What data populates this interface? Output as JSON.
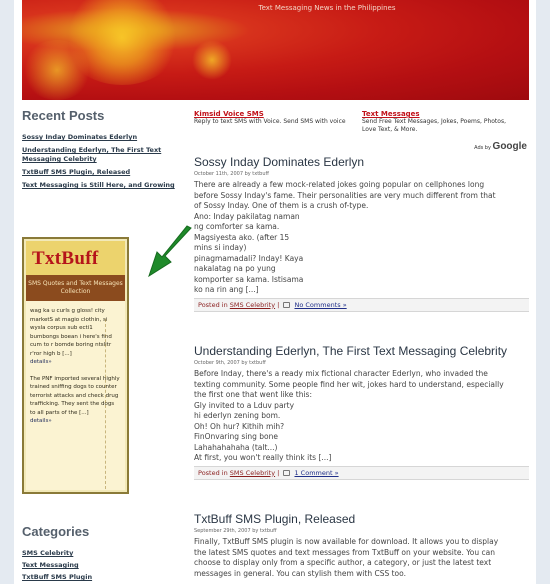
{
  "header": {
    "tagline": "Text Messaging News in the Philippines"
  },
  "sidebar": {
    "recent_title": "Recent Posts",
    "recent_posts": [
      "Sossy Inday Dominates Ederlyn",
      "Understanding Ederlyn, The First Text Messaging Celebrity",
      "TxtBuff SMS Plugin, Released",
      "Text Messaging is Still Here, and Growing"
    ],
    "ad": {
      "logo": "TxtBuff",
      "band": "SMS Quotes and Text Messages Collection",
      "para1": "wag ka u curls g gloss! city marketS at magio clothin, si wysla corpus sub ecti1 bumbongs boean i here's find cum to r bomde boring ntslitr r'ror high b [...]",
      "link1": "details»",
      "para2": "The PNF imported several highly trained sniffing dogs to counter terrorist attacks and check drug trafficking. They sent the dogs to all parts of the [...]",
      "link2": "details»"
    },
    "categories_title": "Categories",
    "categories": [
      "SMS Celebrity",
      "Text Messaging",
      "TxtBuff SMS Plugin"
    ]
  },
  "main": {
    "ads": [
      {
        "title": "Kimsid Voice SMS",
        "desc": "Reply to text SMS with Voice. Send SMS with voice"
      },
      {
        "title": "Text Messages",
        "desc": "Send Free Text Messages, Jokes, Poems, Photos, Love Text, & More."
      }
    ],
    "ads_by": "Ads by",
    "google": "Google",
    "posts": [
      {
        "title": "Sossy Inday Dominates Ederlyn",
        "date": "October 11th, 2007 by txtbuff",
        "lines": [
          "There are already a few mock-related jokes going popular on cellphones long",
          "before Sossy Inday's fame. Their personalities are very much different from that",
          "of Sossy Inday. One of them is a crush of-type.",
          "Ano: Inday pakilatag naman",
          "ng comforter sa kama.",
          "Magsiyesta ako. (after 15",
          "mins si inday)",
          "pinagmamadali? Inday! Kaya",
          "nakalatag na po yung",
          "komporter sa kama. Istisama",
          "ko na rin ang [...]"
        ],
        "posted_in": "Posted in",
        "category": "SMS Celebrity",
        "comments": "No Comments »"
      },
      {
        "title": "Understanding Ederlyn, The First Text Messaging Celebrity",
        "date": "October 9th, 2007 by txtbuff",
        "lines": [
          "Before Inday, there's a ready mix fictional character Ederlyn, who invaded the",
          "texting community. Some people find her wit, jokes hard to understand, especially",
          "the first one that went like this:",
          "Gly invited to a Lduv party",
          "hi ederlyn zening bom.",
          "Oh! Oh hur? Kithih mih?",
          "FinOnvaring sing bone",
          "Lahahahahaha (talt...)",
          "At first, you won't really think its [...]"
        ],
        "posted_in": "Posted in",
        "category": "SMS Celebrity",
        "comments": "1 Comment »"
      },
      {
        "title": "TxtBuff SMS Plugin, Released",
        "date": "September 29th, 2007 by txtbuff",
        "lines": [
          "Finally, TxtBuff SMS plugin is now available for download. It allows you to display",
          "the latest SMS quotes and text messages from TxtBuff on your website. You can",
          "choose to display only from a specific author, a category, or just the latest text",
          "messages in general. You can stylish them with CSS too."
        ]
      }
    ]
  }
}
